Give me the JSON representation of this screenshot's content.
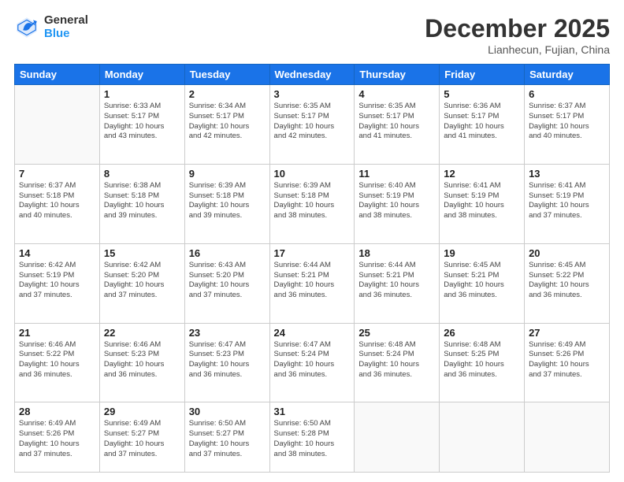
{
  "header": {
    "logo_general": "General",
    "logo_blue": "Blue",
    "title": "December 2025",
    "location": "Lianhecun, Fujian, China"
  },
  "days_of_week": [
    "Sunday",
    "Monday",
    "Tuesday",
    "Wednesday",
    "Thursday",
    "Friday",
    "Saturday"
  ],
  "weeks": [
    [
      {
        "day": "",
        "info": ""
      },
      {
        "day": "1",
        "info": "Sunrise: 6:33 AM\nSunset: 5:17 PM\nDaylight: 10 hours\nand 43 minutes."
      },
      {
        "day": "2",
        "info": "Sunrise: 6:34 AM\nSunset: 5:17 PM\nDaylight: 10 hours\nand 42 minutes."
      },
      {
        "day": "3",
        "info": "Sunrise: 6:35 AM\nSunset: 5:17 PM\nDaylight: 10 hours\nand 42 minutes."
      },
      {
        "day": "4",
        "info": "Sunrise: 6:35 AM\nSunset: 5:17 PM\nDaylight: 10 hours\nand 41 minutes."
      },
      {
        "day": "5",
        "info": "Sunrise: 6:36 AM\nSunset: 5:17 PM\nDaylight: 10 hours\nand 41 minutes."
      },
      {
        "day": "6",
        "info": "Sunrise: 6:37 AM\nSunset: 5:17 PM\nDaylight: 10 hours\nand 40 minutes."
      }
    ],
    [
      {
        "day": "7",
        "info": "Sunrise: 6:37 AM\nSunset: 5:18 PM\nDaylight: 10 hours\nand 40 minutes."
      },
      {
        "day": "8",
        "info": "Sunrise: 6:38 AM\nSunset: 5:18 PM\nDaylight: 10 hours\nand 39 minutes."
      },
      {
        "day": "9",
        "info": "Sunrise: 6:39 AM\nSunset: 5:18 PM\nDaylight: 10 hours\nand 39 minutes."
      },
      {
        "day": "10",
        "info": "Sunrise: 6:39 AM\nSunset: 5:18 PM\nDaylight: 10 hours\nand 38 minutes."
      },
      {
        "day": "11",
        "info": "Sunrise: 6:40 AM\nSunset: 5:19 PM\nDaylight: 10 hours\nand 38 minutes."
      },
      {
        "day": "12",
        "info": "Sunrise: 6:41 AM\nSunset: 5:19 PM\nDaylight: 10 hours\nand 38 minutes."
      },
      {
        "day": "13",
        "info": "Sunrise: 6:41 AM\nSunset: 5:19 PM\nDaylight: 10 hours\nand 37 minutes."
      }
    ],
    [
      {
        "day": "14",
        "info": "Sunrise: 6:42 AM\nSunset: 5:19 PM\nDaylight: 10 hours\nand 37 minutes."
      },
      {
        "day": "15",
        "info": "Sunrise: 6:42 AM\nSunset: 5:20 PM\nDaylight: 10 hours\nand 37 minutes."
      },
      {
        "day": "16",
        "info": "Sunrise: 6:43 AM\nSunset: 5:20 PM\nDaylight: 10 hours\nand 37 minutes."
      },
      {
        "day": "17",
        "info": "Sunrise: 6:44 AM\nSunset: 5:21 PM\nDaylight: 10 hours\nand 36 minutes."
      },
      {
        "day": "18",
        "info": "Sunrise: 6:44 AM\nSunset: 5:21 PM\nDaylight: 10 hours\nand 36 minutes."
      },
      {
        "day": "19",
        "info": "Sunrise: 6:45 AM\nSunset: 5:21 PM\nDaylight: 10 hours\nand 36 minutes."
      },
      {
        "day": "20",
        "info": "Sunrise: 6:45 AM\nSunset: 5:22 PM\nDaylight: 10 hours\nand 36 minutes."
      }
    ],
    [
      {
        "day": "21",
        "info": "Sunrise: 6:46 AM\nSunset: 5:22 PM\nDaylight: 10 hours\nand 36 minutes."
      },
      {
        "day": "22",
        "info": "Sunrise: 6:46 AM\nSunset: 5:23 PM\nDaylight: 10 hours\nand 36 minutes."
      },
      {
        "day": "23",
        "info": "Sunrise: 6:47 AM\nSunset: 5:23 PM\nDaylight: 10 hours\nand 36 minutes."
      },
      {
        "day": "24",
        "info": "Sunrise: 6:47 AM\nSunset: 5:24 PM\nDaylight: 10 hours\nand 36 minutes."
      },
      {
        "day": "25",
        "info": "Sunrise: 6:48 AM\nSunset: 5:24 PM\nDaylight: 10 hours\nand 36 minutes."
      },
      {
        "day": "26",
        "info": "Sunrise: 6:48 AM\nSunset: 5:25 PM\nDaylight: 10 hours\nand 36 minutes."
      },
      {
        "day": "27",
        "info": "Sunrise: 6:49 AM\nSunset: 5:26 PM\nDaylight: 10 hours\nand 37 minutes."
      }
    ],
    [
      {
        "day": "28",
        "info": "Sunrise: 6:49 AM\nSunset: 5:26 PM\nDaylight: 10 hours\nand 37 minutes."
      },
      {
        "day": "29",
        "info": "Sunrise: 6:49 AM\nSunset: 5:27 PM\nDaylight: 10 hours\nand 37 minutes."
      },
      {
        "day": "30",
        "info": "Sunrise: 6:50 AM\nSunset: 5:27 PM\nDaylight: 10 hours\nand 37 minutes."
      },
      {
        "day": "31",
        "info": "Sunrise: 6:50 AM\nSunset: 5:28 PM\nDaylight: 10 hours\nand 38 minutes."
      },
      {
        "day": "",
        "info": ""
      },
      {
        "day": "",
        "info": ""
      },
      {
        "day": "",
        "info": ""
      }
    ]
  ]
}
